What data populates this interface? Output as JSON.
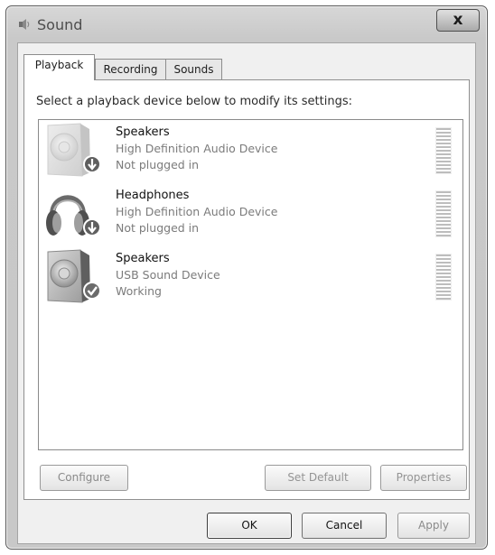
{
  "window": {
    "title": "Sound",
    "close_label": "x"
  },
  "tabs": [
    {
      "label": "Playback",
      "active": true
    },
    {
      "label": "Recording",
      "active": false
    },
    {
      "label": "Sounds",
      "active": false
    }
  ],
  "instruction": "Select a playback device below to modify its settings:",
  "devices": [
    {
      "name": "Speakers",
      "description": "High Definition Audio Device",
      "status": "Not plugged in",
      "icon": "speaker-icon",
      "badge_icon": "down-arrow-badge-icon"
    },
    {
      "name": "Headphones",
      "description": "High Definition Audio Device",
      "status": "Not plugged in",
      "icon": "headphones-icon",
      "badge_icon": "down-arrow-badge-icon"
    },
    {
      "name": "Speakers",
      "description": "USB Sound Device",
      "status": "Working",
      "icon": "speaker-icon",
      "badge_icon": "checkmark-badge-icon"
    }
  ],
  "buttons": {
    "configure": "Configure",
    "set_default": "Set Default",
    "properties": "Properties",
    "ok": "OK",
    "cancel": "Cancel",
    "apply": "Apply"
  }
}
